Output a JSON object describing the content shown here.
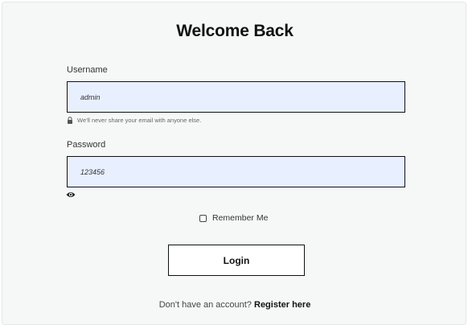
{
  "form": {
    "title": "Welcome Back",
    "username": {
      "label": "Username",
      "value": "admin",
      "help_icon": "lock-icon",
      "help_text": "We'll never share your email with anyone else."
    },
    "password": {
      "label": "Password",
      "value": "123456",
      "toggle_icon": "eye-icon"
    },
    "remember": {
      "label": "Remember Me",
      "checked": false
    },
    "login_label": "Login",
    "register": {
      "prompt": "Don't have an account?",
      "link_label": "Register here"
    }
  },
  "colors": {
    "background": "#f6f8f8",
    "input_fill": "#e8efff",
    "border": "#111111"
  }
}
